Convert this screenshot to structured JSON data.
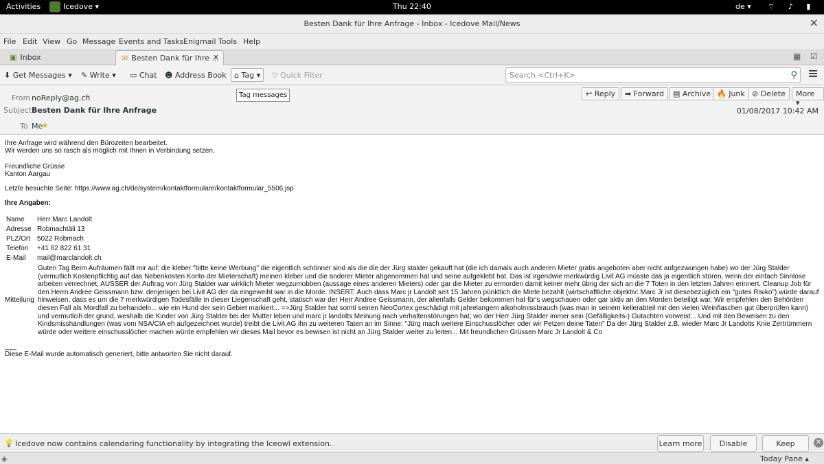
{
  "topbar": {
    "activities": "Activities",
    "app": "Icedove ▾",
    "clock": "Thu 22:40",
    "lang": "de ▾",
    "sys": "⌔ ♪ ▮ ▾"
  },
  "window": {
    "title": "Besten Dank für Ihre Anfrage - Inbox - Icedove Mail/News",
    "close": "✕"
  },
  "menu": [
    "File",
    "Edit",
    "View",
    "Go",
    "Message",
    "Events and Tasks",
    "Enigmail",
    "Tools",
    "Help"
  ],
  "tabs": [
    {
      "icon": "inbox-icon",
      "label": "Inbox"
    },
    {
      "icon": "envelope-icon",
      "label": "Besten Dank für Ihre ...",
      "close": "✕"
    }
  ],
  "toolbar": {
    "get_messages": "Get Messages",
    "write": "Write",
    "chat": "Chat",
    "address_book": "Address Book",
    "tag": "Tag",
    "quick_filter": "Quick Filter",
    "search_placeholder": "Search <Ctrl+K>"
  },
  "tooltip": "Tag messages",
  "header": {
    "from_label": "From",
    "from": "noReply@ag.ch",
    "subject_label": "Subject",
    "subject": "Besten Dank für Ihre Anfrage",
    "to_label": "To",
    "to": "Me",
    "date": "01/08/2017 10:42 AM"
  },
  "actions": [
    "Reply",
    "Forward",
    "Archive",
    "Junk",
    "Delete",
    "More"
  ],
  "body": {
    "l1": "Ihre Anfrage wird während den Bürozeiten bearbeitet.",
    "l2": "Wir werden uns so rasch als möglich mit Ihnen in Verbindung setzen.",
    "l3": "Freundliche Grüsse",
    "l4": "Kanton Aargau",
    "l5": "Letzte besuchte Seite: https://www.ag.ch/de/system/kontaktformulare/kontaktformular_5506.jsp",
    "l6": "Ihre Angaben:",
    "rows": [
      {
        "k": "Name",
        "v": "Herr Marc Landolt"
      },
      {
        "k": "Adresse",
        "v": "Robmachtäli 13"
      },
      {
        "k": "PLZ/Ort",
        "v": "5022 Robmach"
      },
      {
        "k": "Telefon",
        "v": "+41 62 822 61 31"
      },
      {
        "k": "E-Mail",
        "v": "mail@marclandolt.ch"
      }
    ],
    "mitteilung_label": "Mitteilung",
    "mitteilung": "Guten Tag Beim Aufräumen fällt mir auf: die kleber \"bitte keine Werbung\" die eigentlich schönner sind als die die der Jürg stalder gekauft hat (die ich damals auch anderen Mieter gratis angeboten aber nicht aufgezwungen habe) wo der Jürg Stalder (vermutlich Kostenpflichtig auf das Nebenkosten Konto der Mieterschaft) meinen kleber und die anderer Mieter abgenommen hat und seine aufgeklebt hat. Das ist irgendwie merkwürdig Livit AG müsste das ja eigentlich stören, wenn der einfach Sinnlose arbeiten verrechnet, AUSSER der Auftrag von Jürg Stalder war wirklich Mieter wegzumobben (aussage eines anderen Mieters) oder gar die Mieter zu ermorden damit keiner mehr übrig der sich an die 7 Toten in den letzten Jahren erinnert. Cleanup Job für den Herrn Andree Geissmann bzw. denjenigen bei Livit AG der da eingeweiht war in die Morde. INSERT: Auch dass Marc jr Landolt seit 15 Jahren pünktlich die Miete bezahlt (wirtschaftliche objektiv: Marc Jr ist diesebezüglich ein \"gutes Risiko\") würde darauf hinweisen, dass es um die 7 merkwürdigen Todesfälle in dieser Liegenschaft geht, statisch war der Herr Andree Geissmann, der allenfalls Gelder bekommen hat für's wegschauen oder gar aktiv an den Morden beteiligt war. Wir empfehlen den Behörden diesen Fall als Mordfall zu behandeln... wie ein Hund der sein Gebiet markiert... =>Jürg Stalder hat somti seinen NeoCortex geschädigt mit jahrelangem alkoholmissbrauch (was man in seinem kellerabteil mit den vielen Weinflaschen gut überprüfen kann) und vermutlcih der grund, weshalb die Kinder von Jürg Stalder bei der Mutter leben und marc jr landolts Meinung nach verhaltenstörungen hat, wo der Herr Jürg Stalder immer sein (Gefälligkeits-) Gutachten vorweist... Und mit den Beweisen zu den Kindsmisshandlungen (was vom NSA/CIA eh aufgezeichnet wurde) treibt die Livit AG ihn zu weiteren Taten an im Sinne: \"Jürg mach weitere Einschusslöcher oder wir Petzen deine Taten\" Da der Jürg Stalder z.B. wieder Marc Jr Landolts Knie Zertrümmern würde oder weitere einschusslöcher machen würde empfehlen wir dieses Mail bevor es bewisen ist nicht an Jürg Stalder weiter zu leiten... Mit freundlichen Grüssen Marc Jr Landolt & Co",
    "sep": "___",
    "footer": "Diese E-Mail wurde automatisch generiert, bitte antworten Sie nicht darauf."
  },
  "notification": {
    "text": "Icedove now contains calendaring functionality by integrating the Iceowl extension.",
    "learn_more": "Learn more",
    "disable": "Disable",
    "keep": "Keep",
    "close": "✕"
  },
  "status": {
    "today_pane": "Today Pane ▴"
  }
}
